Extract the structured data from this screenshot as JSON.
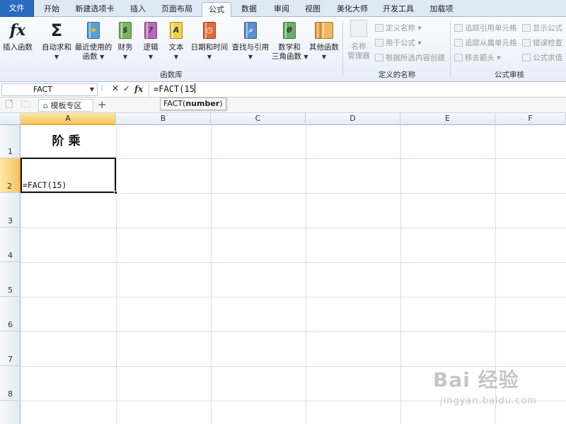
{
  "tabs": {
    "file": "文件",
    "items": [
      "开始",
      "新建选项卡",
      "插入",
      "页面布局",
      "公式",
      "数据",
      "审阅",
      "视图",
      "美化大师",
      "开发工具",
      "加载项"
    ],
    "active": "公式"
  },
  "ribbon": {
    "insert_function": "插入函数",
    "autosum": "自动求和",
    "recent": "最近使用的",
    "recent2": "函数",
    "financial": "财务",
    "logical": "逻辑",
    "text": "文本",
    "datetime": "日期和时间",
    "lookup": "查找与引用",
    "math": "数学和",
    "math2": "三角函数",
    "more": "其他函数",
    "group_library": "函数库",
    "name_manager": "名称",
    "name_manager2": "管理器",
    "define_name": "定义名称",
    "use_in_formula": "用于公式",
    "create_from_selection": "根据所选内容创建",
    "group_defined_names": "定义的名称",
    "trace_precedents": "追踪引用单元格",
    "trace_dependents": "追踪从属单元格",
    "remove_arrows": "移去箭头",
    "show_formulas": "显示公式",
    "error_checking": "错误检查",
    "evaluate_formula": "公式求值",
    "group_auditing": "公式审核",
    "fx_symbol": "fx",
    "sigma_symbol": "Σ"
  },
  "formula_bar": {
    "name_box": "FACT",
    "cancel": "✕",
    "enter": "✓",
    "fx": "fx",
    "formula": "=FACT(15"
  },
  "tooltip": {
    "func": "FACT(",
    "arg": "number",
    "close": ")"
  },
  "template_bar": {
    "template_tab": "模板专区",
    "add": "+"
  },
  "sheet": {
    "columns": [
      "A",
      "B",
      "C",
      "D",
      "E",
      "F"
    ],
    "rows": [
      "1",
      "2",
      "3",
      "4",
      "5",
      "6",
      "7",
      "8"
    ],
    "a1": "阶乘",
    "a2": "=FACT(15)"
  },
  "watermark": {
    "logo": "Bai 经验",
    "url": "jingyan.baidu.com"
  },
  "colors": {
    "file_tab": "#2a6bbf",
    "selection_header": "#f7c665",
    "ribbon_bg": "#e6eef8"
  }
}
